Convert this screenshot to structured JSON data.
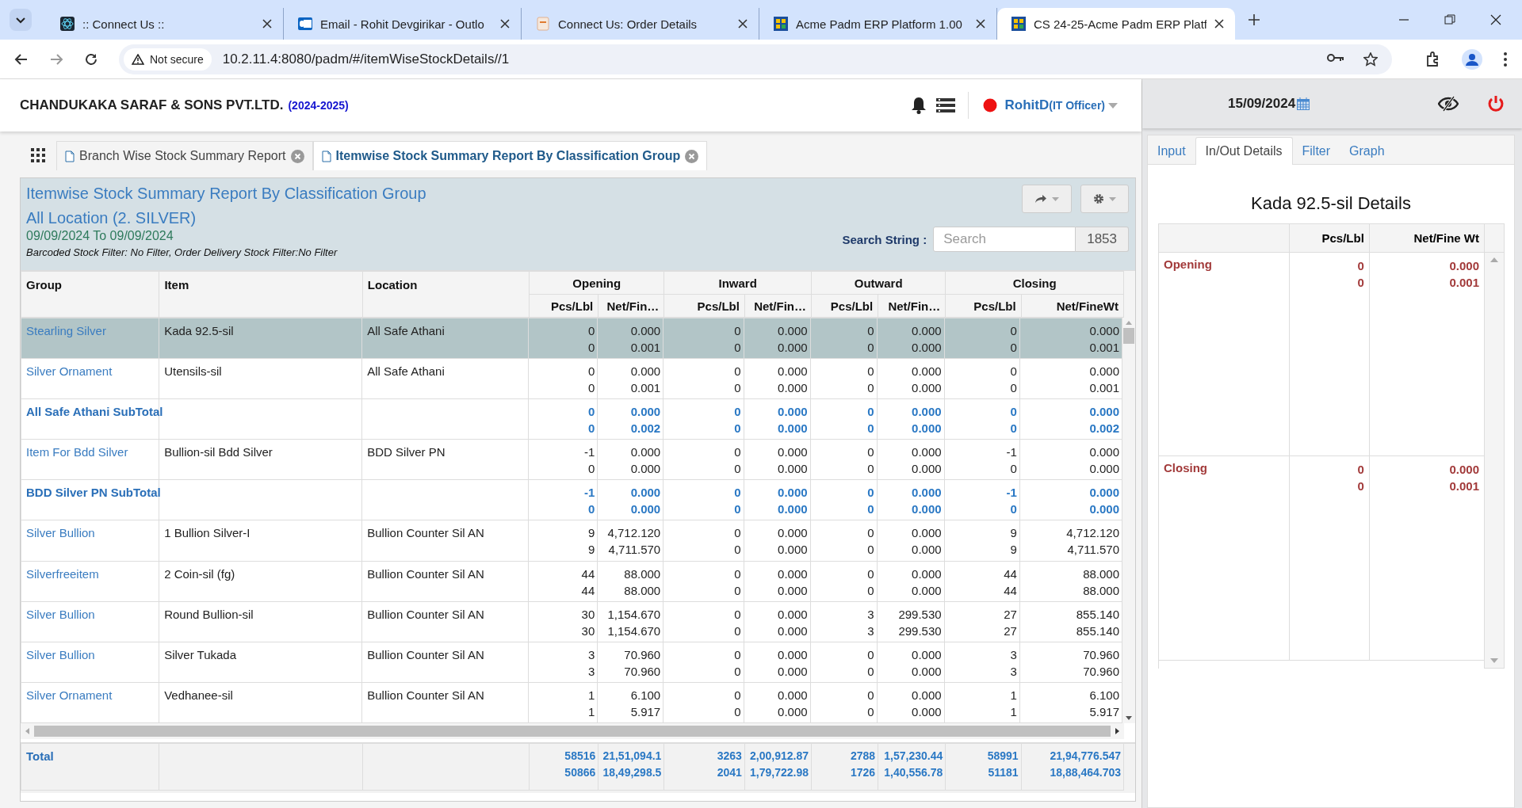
{
  "browser": {
    "tabs": [
      {
        "title": ":: Connect Us ::",
        "selected": false
      },
      {
        "title": "Email - Rohit Devgirikar - Outlo",
        "selected": false
      },
      {
        "title": "Connect Us: Order Details",
        "selected": false
      },
      {
        "title": "Acme Padm ERP Platform 1.00",
        "selected": false
      },
      {
        "title": "CS 24-25-Acme Padm ERP Platf",
        "selected": true
      }
    ],
    "security": "Not secure",
    "url": "10.2.11.4:8080/padm/#/itemWiseStockDetails//1"
  },
  "header": {
    "company": "CHANDUKAKA SARAF & SONS PVT.LTD.",
    "year": "(2024-2025)",
    "user": "RohitD",
    "role": "(IT Officer)"
  },
  "page_tabs": [
    {
      "label": "Branch Wise Stock Summary Report",
      "selected": false
    },
    {
      "label": "Itemwise Stock Summary Report By Classification Group",
      "selected": true
    }
  ],
  "report": {
    "title": "Itemwise Stock Summary Report By Classification Group",
    "location": "All Location (2. SILVER)",
    "period": "09/09/2024 To 09/09/2024",
    "filters": "Barcoded Stock Filter: No Filter, Order Delivery Stock Filter:No Filter",
    "search_label": "Search String :",
    "search_placeholder": "Search",
    "count": "1853",
    "table": {
      "columns": [
        "Group",
        "Item",
        "Location"
      ],
      "groups": [
        "Opening",
        "Inward",
        "Outward",
        "Closing"
      ],
      "subcolumns": [
        "Pcs/Lbl",
        "Net/Fin…",
        "Pcs/Lbl",
        "Net/Fin…",
        "Pcs/Lbl",
        "Net/Fin…",
        "Pcs/Lbl",
        "Net/FineWt"
      ],
      "rows": [
        {
          "kind": "item",
          "selected": true,
          "group": "Stearling Silver",
          "item": "Kada 92.5-sil",
          "location": "All Safe Athani",
          "cells": [
            [
              "0",
              "0"
            ],
            [
              "0.000",
              "0.001"
            ],
            [
              "0",
              "0"
            ],
            [
              "0.000",
              "0.000"
            ],
            [
              "0",
              "0"
            ],
            [
              "0.000",
              "0.000"
            ],
            [
              "0",
              "0"
            ],
            [
              "0.000",
              "0.001"
            ]
          ]
        },
        {
          "kind": "item",
          "selected": false,
          "group": "Silver Ornament",
          "item": "Utensils-sil",
          "location": "All Safe Athani",
          "cells": [
            [
              "0",
              "0"
            ],
            [
              "0.000",
              "0.001"
            ],
            [
              "0",
              "0"
            ],
            [
              "0.000",
              "0.000"
            ],
            [
              "0",
              "0"
            ],
            [
              "0.000",
              "0.000"
            ],
            [
              "0",
              "0"
            ],
            [
              "0.000",
              "0.001"
            ]
          ]
        },
        {
          "kind": "subtotal",
          "selected": false,
          "group": "All Safe Athani SubTotal",
          "cells": [
            [
              "0",
              "0"
            ],
            [
              "0.000",
              "0.002"
            ],
            [
              "0",
              "0"
            ],
            [
              "0.000",
              "0.000"
            ],
            [
              "0",
              "0"
            ],
            [
              "0.000",
              "0.000"
            ],
            [
              "0",
              "0"
            ],
            [
              "0.000",
              "0.002"
            ]
          ]
        },
        {
          "kind": "item",
          "selected": false,
          "group": "Item For Bdd Silver",
          "item": "Bullion-sil Bdd Silver",
          "location": "BDD Silver PN",
          "cells": [
            [
              "-1",
              "0"
            ],
            [
              "0.000",
              "0.000"
            ],
            [
              "0",
              "0"
            ],
            [
              "0.000",
              "0.000"
            ],
            [
              "0",
              "0"
            ],
            [
              "0.000",
              "0.000"
            ],
            [
              "-1",
              "0"
            ],
            [
              "0.000",
              "0.000"
            ]
          ]
        },
        {
          "kind": "subtotal",
          "selected": false,
          "group": "BDD Silver PN SubTotal",
          "cells": [
            [
              "-1",
              "0"
            ],
            [
              "0.000",
              "0.000"
            ],
            [
              "0",
              "0"
            ],
            [
              "0.000",
              "0.000"
            ],
            [
              "0",
              "0"
            ],
            [
              "0.000",
              "0.000"
            ],
            [
              "-1",
              "0"
            ],
            [
              "0.000",
              "0.000"
            ]
          ]
        },
        {
          "kind": "item",
          "selected": false,
          "group": "Silver Bullion",
          "item": "1 Bullion Silver-I",
          "location": "Bullion Counter Sil AN",
          "cells": [
            [
              "9",
              "9"
            ],
            [
              "4,712.120",
              "4,711.570"
            ],
            [
              "0",
              "0"
            ],
            [
              "0.000",
              "0.000"
            ],
            [
              "0",
              "0"
            ],
            [
              "0.000",
              "0.000"
            ],
            [
              "9",
              "9"
            ],
            [
              "4,712.120",
              "4,711.570"
            ]
          ]
        },
        {
          "kind": "item",
          "selected": false,
          "group": "Silverfreeitem",
          "item": "2 Coin-sil (fg)",
          "location": "Bullion Counter Sil AN",
          "cells": [
            [
              "44",
              "44"
            ],
            [
              "88.000",
              "88.000"
            ],
            [
              "0",
              "0"
            ],
            [
              "0.000",
              "0.000"
            ],
            [
              "0",
              "0"
            ],
            [
              "0.000",
              "0.000"
            ],
            [
              "44",
              "44"
            ],
            [
              "88.000",
              "88.000"
            ]
          ]
        },
        {
          "kind": "item",
          "selected": false,
          "group": "Silver Bullion",
          "item": "Round Bullion-sil",
          "location": "Bullion Counter Sil AN",
          "cells": [
            [
              "30",
              "30"
            ],
            [
              "1,154.670",
              "1,154.670"
            ],
            [
              "0",
              "0"
            ],
            [
              "0.000",
              "0.000"
            ],
            [
              "3",
              "3"
            ],
            [
              "299.530",
              "299.530"
            ],
            [
              "27",
              "27"
            ],
            [
              "855.140",
              "855.140"
            ]
          ]
        },
        {
          "kind": "item",
          "selected": false,
          "group": "Silver Bullion",
          "item": "Silver Tukada",
          "location": "Bullion Counter Sil AN",
          "cells": [
            [
              "3",
              "3"
            ],
            [
              "70.960",
              "70.960"
            ],
            [
              "0",
              "0"
            ],
            [
              "0.000",
              "0.000"
            ],
            [
              "0",
              "0"
            ],
            [
              "0.000",
              "0.000"
            ],
            [
              "3",
              "3"
            ],
            [
              "70.960",
              "70.960"
            ]
          ]
        },
        {
          "kind": "item",
          "selected": false,
          "group": "Silver Ornament",
          "item": "Vedhanee-sil",
          "location": "Bullion Counter Sil AN",
          "cells": [
            [
              "1",
              "1"
            ],
            [
              "6.100",
              "5.917"
            ],
            [
              "0",
              "0"
            ],
            [
              "0.000",
              "0.000"
            ],
            [
              "0",
              "0"
            ],
            [
              "0.000",
              "0.000"
            ],
            [
              "1",
              "1"
            ],
            [
              "6.100",
              "5.917"
            ]
          ]
        }
      ],
      "total": {
        "label": "Total",
        "cells": [
          [
            "58516",
            "50866"
          ],
          [
            "21,51,094.1",
            "18,49,298.5"
          ],
          [
            "3263",
            "2041"
          ],
          [
            "2,00,912.87",
            "1,79,722.98"
          ],
          [
            "2788",
            "1726"
          ],
          [
            "1,57,230.44",
            "1,40,556.78"
          ],
          [
            "58991",
            "51181"
          ],
          [
            "21,94,776.547",
            "18,88,464.703"
          ]
        ]
      }
    }
  },
  "side": {
    "date": "15/09/2024",
    "tabs": [
      {
        "label": "Input",
        "selected": false
      },
      {
        "label": "In/Out Details",
        "selected": true
      },
      {
        "label": "Filter",
        "selected": false
      },
      {
        "label": "Graph",
        "selected": false
      }
    ],
    "title": "Kada 92.5-sil Details",
    "columns": [
      "Pcs/Lbl",
      "Net/Fine Wt"
    ],
    "rows": [
      {
        "label": "Opening",
        "cells": [
          [
            "0",
            "0"
          ],
          [
            "0.000",
            "0.001"
          ]
        ]
      },
      {
        "label": "Closing",
        "cells": [
          [
            "0",
            "0"
          ],
          [
            "0.000",
            "0.001"
          ]
        ]
      }
    ]
  }
}
